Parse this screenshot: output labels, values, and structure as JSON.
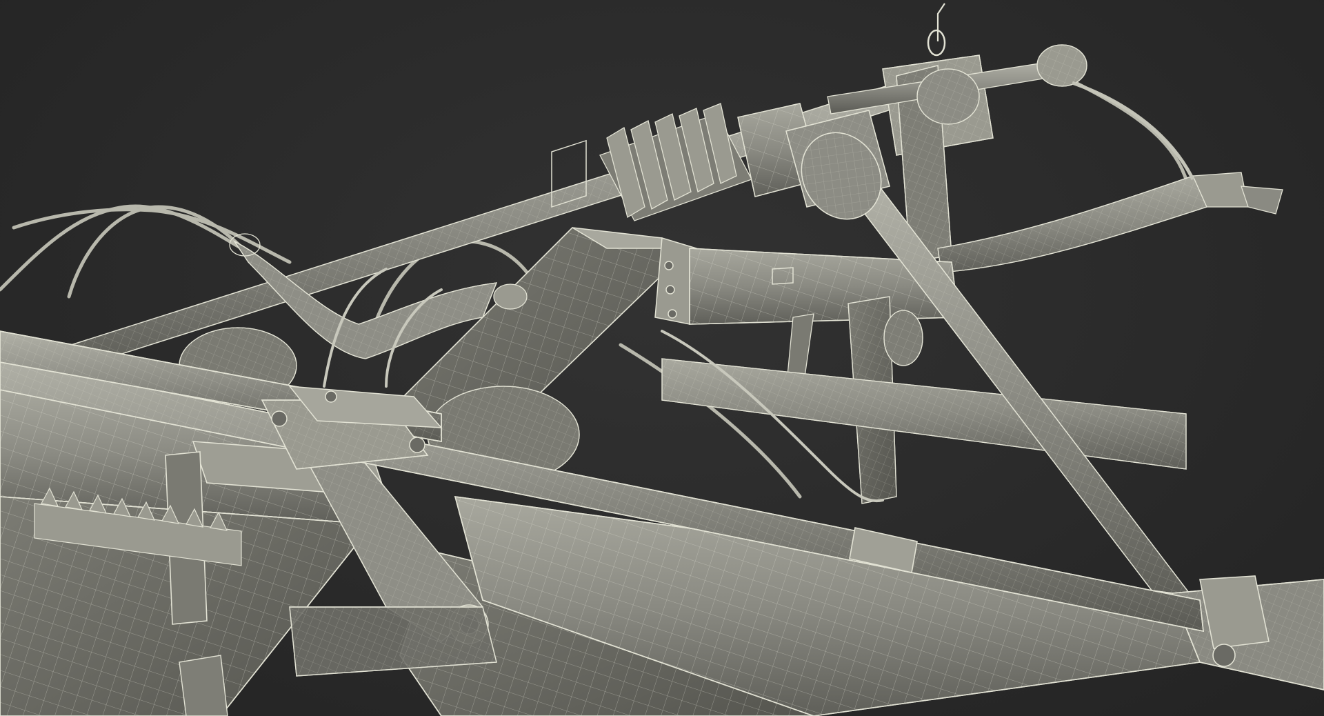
{
  "scene": {
    "background_color": "#2a2a2a",
    "mesh_fill_color": "#8c8c84",
    "mesh_light_color": "#a6a69c",
    "mesh_dark_color": "#5e5e58",
    "wire_color": "#e2e2d4"
  }
}
